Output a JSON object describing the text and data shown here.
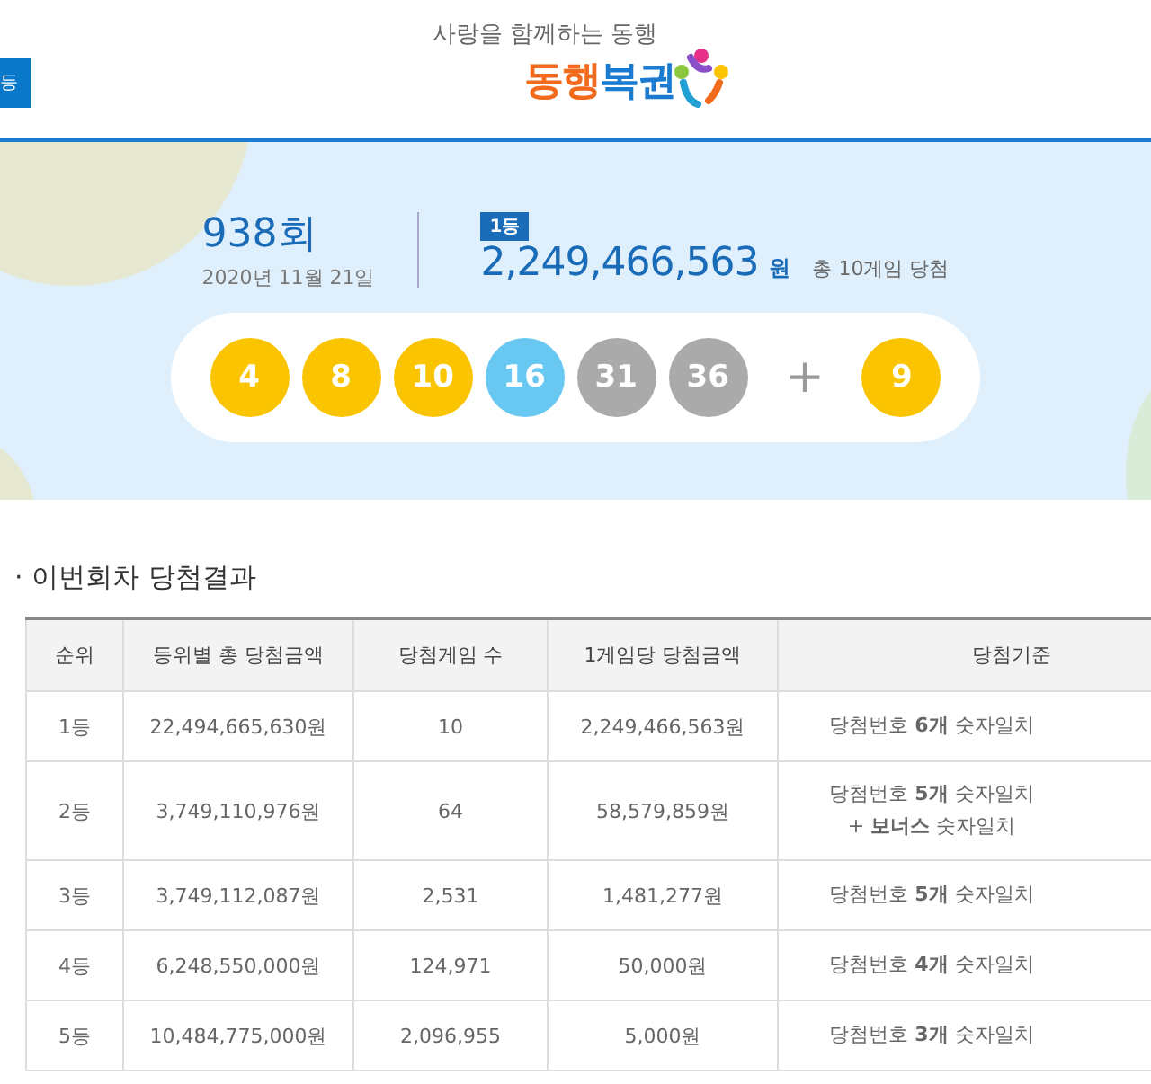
{
  "header": {
    "side_button": "등",
    "slogan": "사랑을 함께하는 동행",
    "logo": [
      {
        "text": "동행",
        "color": "#f26b1d"
      },
      {
        "text": "복권",
        "color": "#1a7bd0"
      }
    ]
  },
  "draw": {
    "round": "938회",
    "date": "2020년 11월 21일",
    "rank_badge": "1등",
    "prize": "2,249,466,563",
    "unit": "원",
    "winners": "총 10게임 당첨",
    "balls": [
      {
        "number": "4",
        "color": "#fbc400"
      },
      {
        "number": "8",
        "color": "#fbc400"
      },
      {
        "number": "10",
        "color": "#fbc400"
      },
      {
        "number": "16",
        "color": "#69c8f2"
      },
      {
        "number": "31",
        "color": "#aaaaaa"
      },
      {
        "number": "36",
        "color": "#aaaaaa"
      }
    ],
    "plus": "+",
    "bonus": {
      "number": "9",
      "color": "#fbc400"
    }
  },
  "results": {
    "bullet": "·",
    "title": "이번회차 당첨결과",
    "columns": [
      "순위",
      "등위별 총 당첨금액",
      "당첨게임 수",
      "1게임당 당첨금액",
      "당첨기준"
    ],
    "rows": [
      {
        "rank": "1등",
        "total": "22,494,665,630원",
        "games": "10",
        "per_game": "2,249,466,563원",
        "criteria": [
          "당첨번호 **6개** 숫자일치"
        ]
      },
      {
        "rank": "2등",
        "total": "3,749,110,976원",
        "games": "64",
        "per_game": "58,579,859원",
        "criteria": [
          "당첨번호 **5개** 숫자일치",
          "+ **보너스** 숫자일치"
        ]
      },
      {
        "rank": "3등",
        "total": "3,749,112,087원",
        "games": "2,531",
        "per_game": "1,481,277원",
        "criteria": [
          "당첨번호 **5개** 숫자일치"
        ]
      },
      {
        "rank": "4등",
        "total": "6,248,550,000원",
        "games": "124,971",
        "per_game": "50,000원",
        "criteria": [
          "당첨번호 **4개** 숫자일치"
        ]
      },
      {
        "rank": "5등",
        "total": "10,484,775,000원",
        "games": "2,096,955",
        "per_game": "5,000원",
        "criteria": [
          "당첨번호 **3개** 숫자일치"
        ]
      }
    ]
  }
}
